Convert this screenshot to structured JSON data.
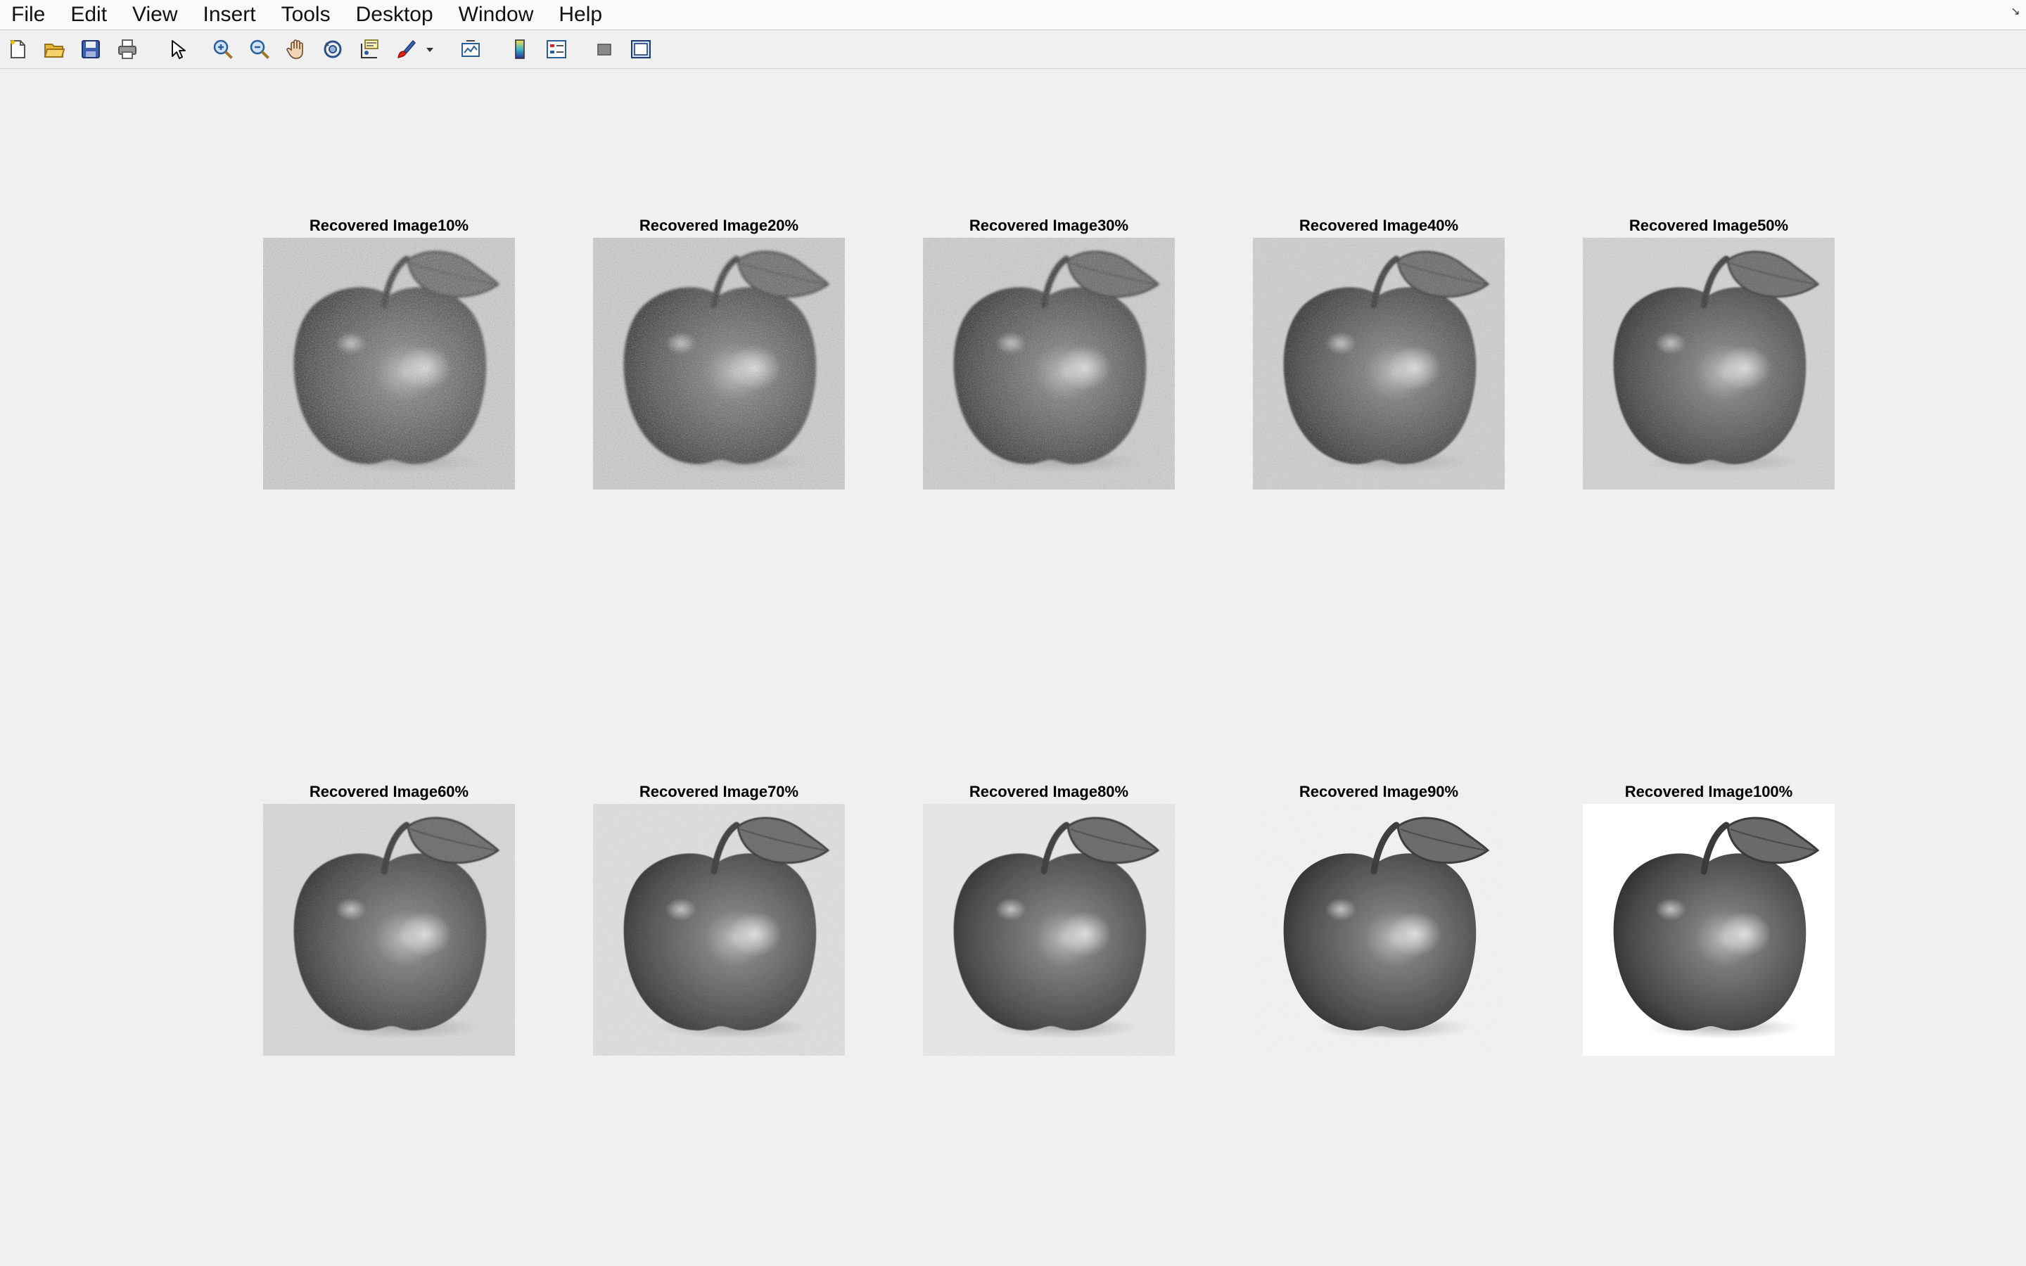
{
  "menubar": {
    "items": [
      "File",
      "Edit",
      "View",
      "Insert",
      "Tools",
      "Desktop",
      "Window",
      "Help"
    ]
  },
  "toolbar": {
    "buttons": [
      "new-figure-icon",
      "open-file-icon",
      "save-icon",
      "print-icon",
      "select-pointer-icon",
      "zoom-in-icon",
      "zoom-out-icon",
      "pan-hand-icon",
      "rotate-3d-icon",
      "data-cursor-icon",
      "brush-icon",
      "brush-dropdown-icon",
      "link-plot-icon",
      "colorbar-icon",
      "legend-icon",
      "hide-plot-tools-icon",
      "show-plot-tools-icon"
    ]
  },
  "figure": {
    "background": "#f0f0f0",
    "panels": [
      {
        "title": "Recovered Image10%",
        "recovery_percent": 10
      },
      {
        "title": "Recovered Image20%",
        "recovery_percent": 20
      },
      {
        "title": "Recovered Image30%",
        "recovery_percent": 30
      },
      {
        "title": "Recovered Image40%",
        "recovery_percent": 40
      },
      {
        "title": "Recovered Image50%",
        "recovery_percent": 50
      },
      {
        "title": "Recovered Image60%",
        "recovery_percent": 60
      },
      {
        "title": "Recovered Image70%",
        "recovery_percent": 70
      },
      {
        "title": "Recovered Image80%",
        "recovery_percent": 80
      },
      {
        "title": "Recovered Image90%",
        "recovery_percent": 90
      },
      {
        "title": "Recovered Image100%",
        "recovery_percent": 100
      }
    ]
  }
}
